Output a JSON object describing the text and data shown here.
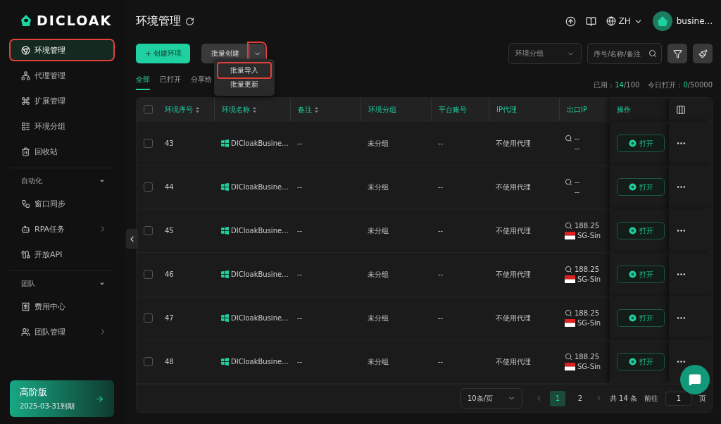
{
  "sidebar": {
    "logo": "DICLOAK",
    "items": [
      {
        "label": "环境管理",
        "selected": true,
        "highlighted": true
      },
      {
        "label": "代理管理",
        "selected": false,
        "highlighted": false
      },
      {
        "label": "扩展管理",
        "selected": false,
        "highlighted": false
      },
      {
        "label": "环境分组",
        "selected": false,
        "highlighted": false
      },
      {
        "label": "回收站",
        "selected": false,
        "highlighted": false
      }
    ],
    "sections": [
      {
        "title": "自动化",
        "items": [
          {
            "label": "窗口同步",
            "arrow": false
          },
          {
            "label": "RPA任务",
            "arrow": true
          },
          {
            "label": "开放API",
            "arrow": false
          }
        ]
      },
      {
        "title": "团队",
        "items": [
          {
            "label": "费用中心",
            "arrow": false
          },
          {
            "label": "团队管理",
            "arrow": true
          }
        ]
      }
    ],
    "plan": {
      "title": "高阶版",
      "expiry": "2025-03-31到期"
    }
  },
  "header": {
    "title": "环境管理",
    "language": "ZH",
    "user": "busine..."
  },
  "toolbar": {
    "create": "创建环境",
    "batch": "批量创建",
    "batch_menu_highlighted": true,
    "group_select": "环境分组",
    "search_placeholder": "序号/名称/备注"
  },
  "batch_menu": [
    {
      "label": "批量导入",
      "highlighted": true
    },
    {
      "label": "批量更新",
      "highlighted": false
    }
  ],
  "tabs": [
    {
      "label": "全部",
      "selected": true
    },
    {
      "label": "已打开",
      "selected": false
    },
    {
      "label": "分享给",
      "selected": false
    }
  ],
  "stats": [
    {
      "label": "已用：",
      "value": "14",
      "total": "/100"
    },
    {
      "label": "今日打开：",
      "value": "0",
      "total": "/50000"
    }
  ],
  "table": {
    "all_checked": false,
    "columns": [
      {
        "label": "环境序号",
        "sortable": true
      },
      {
        "label": "环境名称",
        "sortable": true
      },
      {
        "label": "备注",
        "sortable": true
      },
      {
        "label": "环境分组",
        "sortable": false
      },
      {
        "label": "平台账号",
        "sortable": false
      },
      {
        "label": "IP代理",
        "sortable": false
      },
      {
        "label": "出口IP",
        "sortable": false
      },
      {
        "label": "操作",
        "sortable": false
      }
    ],
    "rows": [
      {
        "checked": false,
        "id": "43",
        "name": "DICloakBusine...",
        "note": "--",
        "group": "未分组",
        "account": "--",
        "proxy": "不使用代理",
        "ip": "--",
        "region": "--",
        "flag": false,
        "action": "打开"
      },
      {
        "checked": false,
        "id": "44",
        "name": "DICloakBusine...",
        "note": "--",
        "group": "未分组",
        "account": "--",
        "proxy": "不使用代理",
        "ip": "--",
        "region": "--",
        "flag": false,
        "action": "打开"
      },
      {
        "checked": false,
        "id": "45",
        "name": "DICloakBusine...",
        "note": "--",
        "group": "未分组",
        "account": "--",
        "proxy": "不使用代理",
        "ip": "188.25",
        "region": "SG-Sin",
        "flag": true,
        "action": "打开"
      },
      {
        "checked": false,
        "id": "46",
        "name": "DICloakBusine...",
        "note": "--",
        "group": "未分组",
        "account": "--",
        "proxy": "不使用代理",
        "ip": "188.25",
        "region": "SG-Sin",
        "flag": true,
        "action": "打开"
      },
      {
        "checked": false,
        "id": "47",
        "name": "DICloakBusine...",
        "note": "--",
        "group": "未分组",
        "account": "--",
        "proxy": "不使用代理",
        "ip": "188.25",
        "region": "SG-Sin",
        "flag": true,
        "action": "打开"
      },
      {
        "checked": false,
        "id": "48",
        "name": "DICloakBusine...",
        "note": "--",
        "group": "未分组",
        "account": "--",
        "proxy": "不使用代理",
        "ip": "188.25",
        "region": "SG-Sin",
        "flag": true,
        "action": "打开"
      }
    ]
  },
  "pagination": {
    "page_size": "10条/页",
    "pages": [
      {
        "label": "1",
        "selected": true
      },
      {
        "label": "2",
        "selected": false
      }
    ],
    "total": "共 14 条",
    "goto_label": "前往",
    "goto_value": "1",
    "goto_suffix": "页"
  }
}
